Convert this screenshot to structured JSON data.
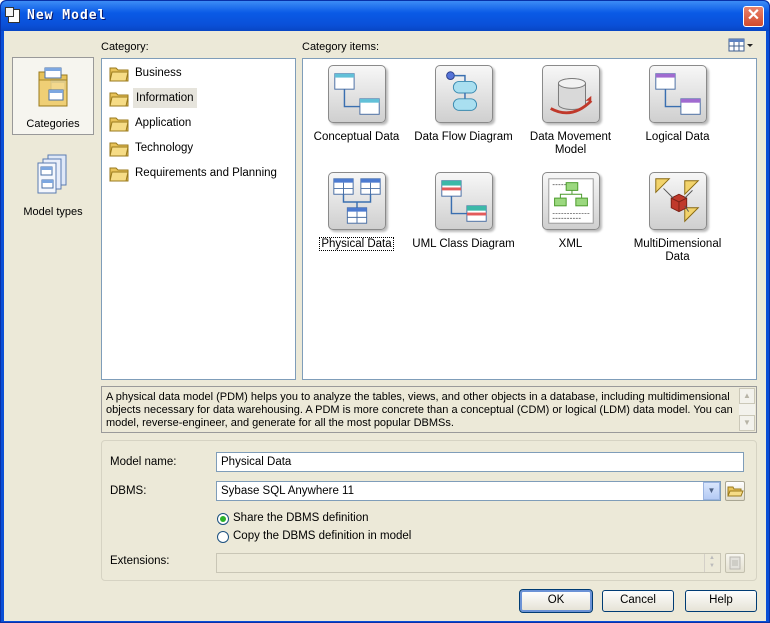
{
  "window": {
    "title": "New Model",
    "close_glyph": "✕"
  },
  "left_bar": {
    "items": [
      {
        "label": "Categories",
        "selected": true,
        "icon": "folder-categories-icon"
      },
      {
        "label": "Model types",
        "selected": false,
        "icon": "model-types-icon"
      }
    ]
  },
  "category": {
    "label": "Category:",
    "items": [
      {
        "label": "Business",
        "selected": false
      },
      {
        "label": "Information",
        "selected": true
      },
      {
        "label": "Application",
        "selected": false
      },
      {
        "label": "Technology",
        "selected": false
      },
      {
        "label": "Requirements and Planning",
        "selected": false
      }
    ]
  },
  "category_items": {
    "label": "Category items:",
    "view_button_icon": "list-view-icon",
    "items": [
      {
        "label": "Conceptual Data",
        "icon": "conceptual-data-icon"
      },
      {
        "label": "Data Flow Diagram",
        "icon": "data-flow-diagram-icon"
      },
      {
        "label": "Data Movement Model",
        "icon": "data-movement-model-icon"
      },
      {
        "label": "Logical Data",
        "icon": "logical-data-icon"
      },
      {
        "label": "Physical Data",
        "icon": "physical-data-icon",
        "focused": true
      },
      {
        "label": "UML Class Diagram",
        "icon": "uml-class-diagram-icon"
      },
      {
        "label": "XML",
        "icon": "xml-icon"
      },
      {
        "label": "MultiDimensional Data",
        "icon": "multidimensional-data-icon"
      }
    ]
  },
  "description": "A physical data model (PDM) helps you to analyze the tables, views, and other objects in a database, including multidimensional objects necessary for data warehousing. A PDM is more concrete than a conceptual (CDM) or logical (LDM) data model. You can model, reverse-engineer, and generate for all the most popular DBMSs.",
  "form": {
    "model_name_label": "Model name:",
    "model_name_value": "Physical Data",
    "dbms_label": "DBMS:",
    "dbms_value": "Sybase SQL Anywhere 11",
    "share_label": "Share the DBMS definition",
    "copy_label": "Copy the DBMS definition in model",
    "share_checked": true,
    "extensions_label": "Extensions:",
    "extensions_value": ""
  },
  "buttons": {
    "ok": "OK",
    "cancel": "Cancel",
    "help": "Help"
  }
}
